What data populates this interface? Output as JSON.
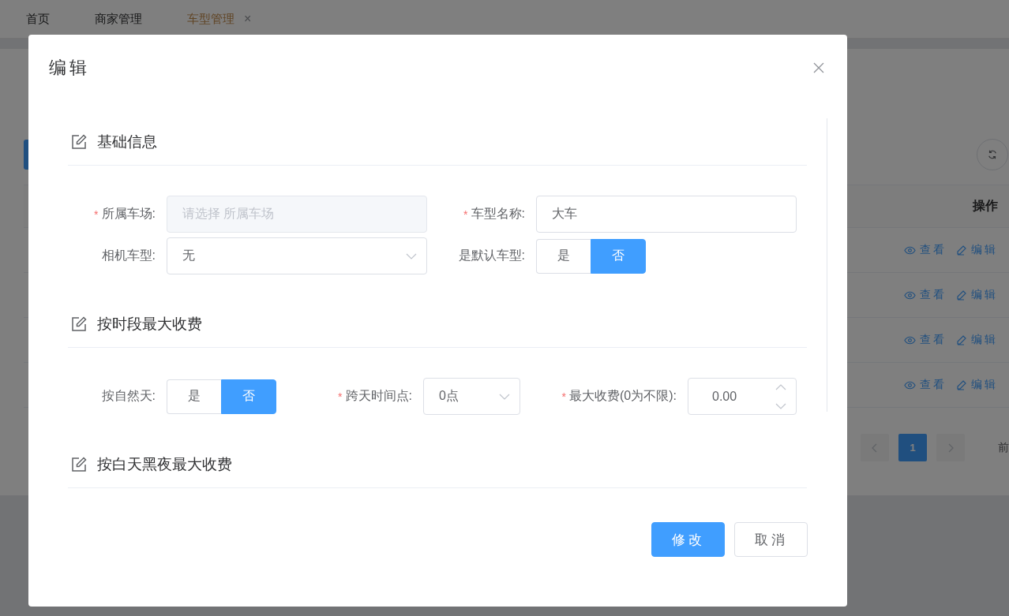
{
  "tabs": [
    {
      "label": "首页",
      "selected": false
    },
    {
      "label": "商家管理",
      "selected": false
    },
    {
      "label": "车型管理",
      "selected": true,
      "close_mark": "×"
    }
  ],
  "table": {
    "columns": [
      "操作"
    ],
    "rows": [
      {
        "actions": [
          {
            "kind": "view",
            "label": "查看"
          },
          {
            "kind": "edit",
            "label": "编辑"
          }
        ]
      },
      {
        "actions": [
          {
            "kind": "view",
            "label": "查看"
          },
          {
            "kind": "edit",
            "label": "编辑"
          }
        ]
      },
      {
        "actions": [
          {
            "kind": "view",
            "label": "查看"
          },
          {
            "kind": "edit",
            "label": "编辑"
          }
        ]
      },
      {
        "actions": [
          {
            "kind": "view",
            "label": "查看"
          },
          {
            "kind": "edit",
            "label": "编辑"
          }
        ]
      }
    ]
  },
  "pagination": {
    "pages": [
      {
        "label": "1",
        "selected": true
      }
    ],
    "total_text": "前"
  },
  "dialog": {
    "title": "编辑",
    "sections": [
      {
        "title": "基础信息",
        "rows": [
          [
            {
              "label": "所属车场:",
              "required_mark": "*",
              "kind": "select",
              "disabled": true,
              "placeholder": "请选择 所属车场"
            },
            {
              "label": "车型名称:",
              "required_mark": "*",
              "kind": "input",
              "value": "大车"
            }
          ],
          [
            {
              "label": "相机车型:",
              "kind": "select",
              "disabled": false,
              "value": "无"
            },
            {
              "label": "是默认车型:",
              "kind": "toggle",
              "options": [
                {
                  "label": "是",
                  "selected": false
                },
                {
                  "label": "否",
                  "selected": true
                }
              ]
            }
          ]
        ]
      },
      {
        "title": "按时段最大收费",
        "rows": [
          [
            {
              "label": "按自然天:",
              "kind": "toggle",
              "options": [
                {
                  "label": "是",
                  "selected": false
                },
                {
                  "label": "否",
                  "selected": true
                }
              ]
            },
            {
              "label": "跨天时间点:",
              "required_mark": "*",
              "kind": "select",
              "disabled": false,
              "value": "0点"
            },
            {
              "label": "最大收费(0为不限):",
              "required_mark": "*",
              "kind": "number",
              "value": "0.00"
            }
          ]
        ]
      },
      {
        "title": "按白天黑夜最大收费"
      }
    ],
    "buttons": [
      {
        "kind": "primary",
        "label": "修改"
      },
      {
        "kind": "default",
        "label": "取消"
      }
    ]
  }
}
